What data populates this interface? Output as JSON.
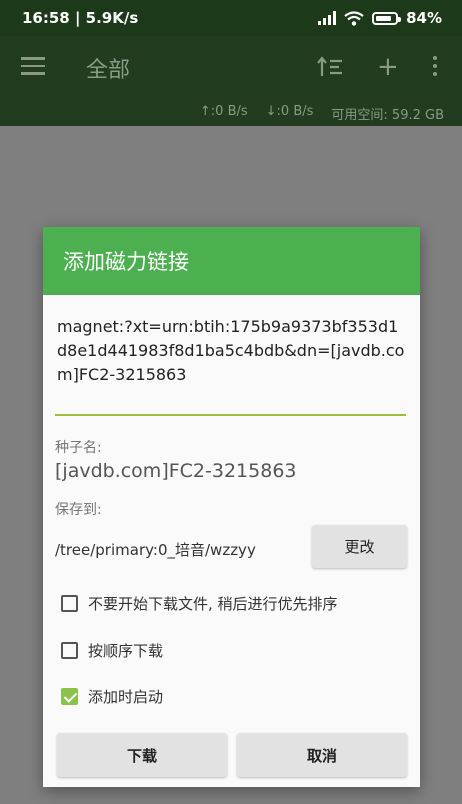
{
  "status_bar": {
    "time_speed": "16:58 | 5.9K/s",
    "battery": "84%",
    "battery_level": 0.84
  },
  "app_bar": {
    "title": "全部",
    "speed_up": "↑:0 B/s",
    "speed_down": "↓:0 B/s",
    "free_space": "可用空间: 59.2 GB"
  },
  "dialog": {
    "title": "添加磁力链接",
    "magnet": "magnet:?xt=urn:btih:175b9a9373bf353d1d8e1d441983f8d1ba5c4bdb&dn=[javdb.com]FC2-3215863",
    "torrent_name_label": "种子名:",
    "torrent_name": "[javdb.com]FC2-3215863",
    "save_to_label": "保存到:",
    "save_path": "/tree/primary:0_培音/wzzyy",
    "change_label": "更改",
    "options": [
      {
        "label": "不要开始下载文件, 稍后进行优先排序",
        "checked": false
      },
      {
        "label": "按顺序下载",
        "checked": false
      },
      {
        "label": "添加时启动",
        "checked": true
      }
    ],
    "download_label": "下载",
    "cancel_label": "取消"
  },
  "colors": {
    "accent": "#4caf50",
    "checkbox_accent": "#8bc34a",
    "appbar": "#213c1e"
  }
}
